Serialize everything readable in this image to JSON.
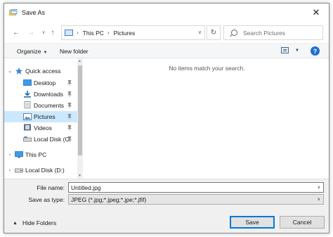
{
  "window": {
    "title": "Save As"
  },
  "address": {
    "segments": [
      "This PC",
      "Pictures"
    ]
  },
  "search": {
    "placeholder": "Search Pictures"
  },
  "toolbar": {
    "organize_label": "Organize",
    "new_folder_label": "New folder",
    "help_label": "?"
  },
  "nav": {
    "quick_access": "Quick access",
    "items": [
      "Desktop",
      "Downloads",
      "Documents",
      "Pictures",
      "Videos",
      "Local Disk (C:"
    ],
    "this_pc": "This PC",
    "local_disk_d": "Local Disk (D:)"
  },
  "file_list": {
    "empty_message": "No items match your search."
  },
  "form": {
    "file_name_label": "File name:",
    "file_name_value": "Untitled.jpg",
    "save_type_label": "Save as type:",
    "save_type_value": "JPEG (*.jpg;*.jpeg;*.jpe;*.jfif)"
  },
  "footer": {
    "hide_folders_label": "Hide Folders",
    "save_label": "Save",
    "cancel_label": "Cancel"
  },
  "colors": {
    "accent": "#0078d7",
    "selection": "#cce8ff",
    "help_blue": "#1e6fd1"
  },
  "icons": {
    "app": "save-dialog-icon",
    "close": "close-icon",
    "back": "arrow-left-icon",
    "forward": "arrow-right-icon",
    "up": "arrow-up-icon",
    "refresh": "refresh-icon",
    "search": "search-icon",
    "help": "help-icon",
    "quick_access": "star-icon",
    "desktop": "desktop-icon",
    "downloads": "download-icon",
    "documents": "documents-icon",
    "pictures": "pictures-icon",
    "videos": "videos-icon",
    "drive": "drive-icon",
    "this_pc": "computer-icon",
    "pin": "pin-icon"
  }
}
